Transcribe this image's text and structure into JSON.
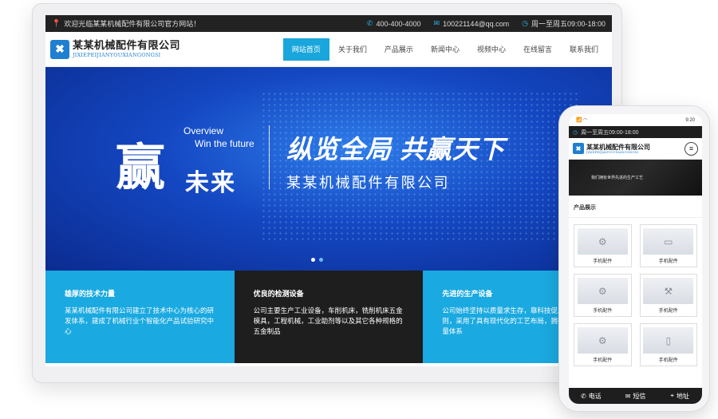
{
  "topbar": {
    "welcome": "欢迎光临某某机械配件有限公司官方网站！",
    "phone": "400-400-4000",
    "email": "100221144@qq.com",
    "hours": "周一至周五09:00-18:00"
  },
  "logo": {
    "cn": "某某机械配件有限公司",
    "en": "JIXIEPEIJIANYOUXIANGONGSI"
  },
  "nav": [
    {
      "label": "网站首页"
    },
    {
      "label": "关于我们"
    },
    {
      "label": "产品展示"
    },
    {
      "label": "新闻中心"
    },
    {
      "label": "视频中心"
    },
    {
      "label": "在线留言"
    },
    {
      "label": "联系我们"
    }
  ],
  "hero": {
    "big_char": "赢",
    "sub_chars": "未来",
    "overview": "Overview",
    "future": "Win the future",
    "title": "纵览全局 共赢天下",
    "company": "某某机械配件有限公司"
  },
  "features": [
    {
      "title": "雄厚的技术力量",
      "text": "某某机械配件有限公司建立了技术中心为核心的研发体系，建成了机械行业个智能化产品试验研究中心"
    },
    {
      "title": "优良的检测设备",
      "text": "公司主要生产工业设备，车削机床，铣削机床五金模具，工程机械，工业助剂等以及其它各种规格的五金制品"
    },
    {
      "title": "先进的生产设备",
      "text": "公司始终坚持以质量求生存，靠科技促发展的原则，采用了具有现代化的工艺布局，拥有完善的质量体系"
    }
  ],
  "phone": {
    "status_left": "📶 ◠",
    "status_right": "9:20",
    "hours": "周一至周五09:00-18:00",
    "banner_text": "我们拥有世界先进的生产工艺",
    "section_title": "产品展示",
    "products": [
      {
        "label": "手机配件"
      },
      {
        "label": "手机配件"
      },
      {
        "label": "手机配件"
      },
      {
        "label": "手机配件"
      },
      {
        "label": "手机配件"
      },
      {
        "label": "手机配件"
      }
    ],
    "footer": [
      {
        "label": "电话"
      },
      {
        "label": "短信"
      },
      {
        "label": "地址"
      }
    ]
  },
  "icons": {
    "location": "location-icon",
    "phone": "phone-icon",
    "mail": "mail-icon",
    "clock": "clock-icon",
    "menu": "menu-icon"
  },
  "colors": {
    "accent": "#19a6dc",
    "dark": "#1e1e1e",
    "brand": "#1f7fd1"
  }
}
